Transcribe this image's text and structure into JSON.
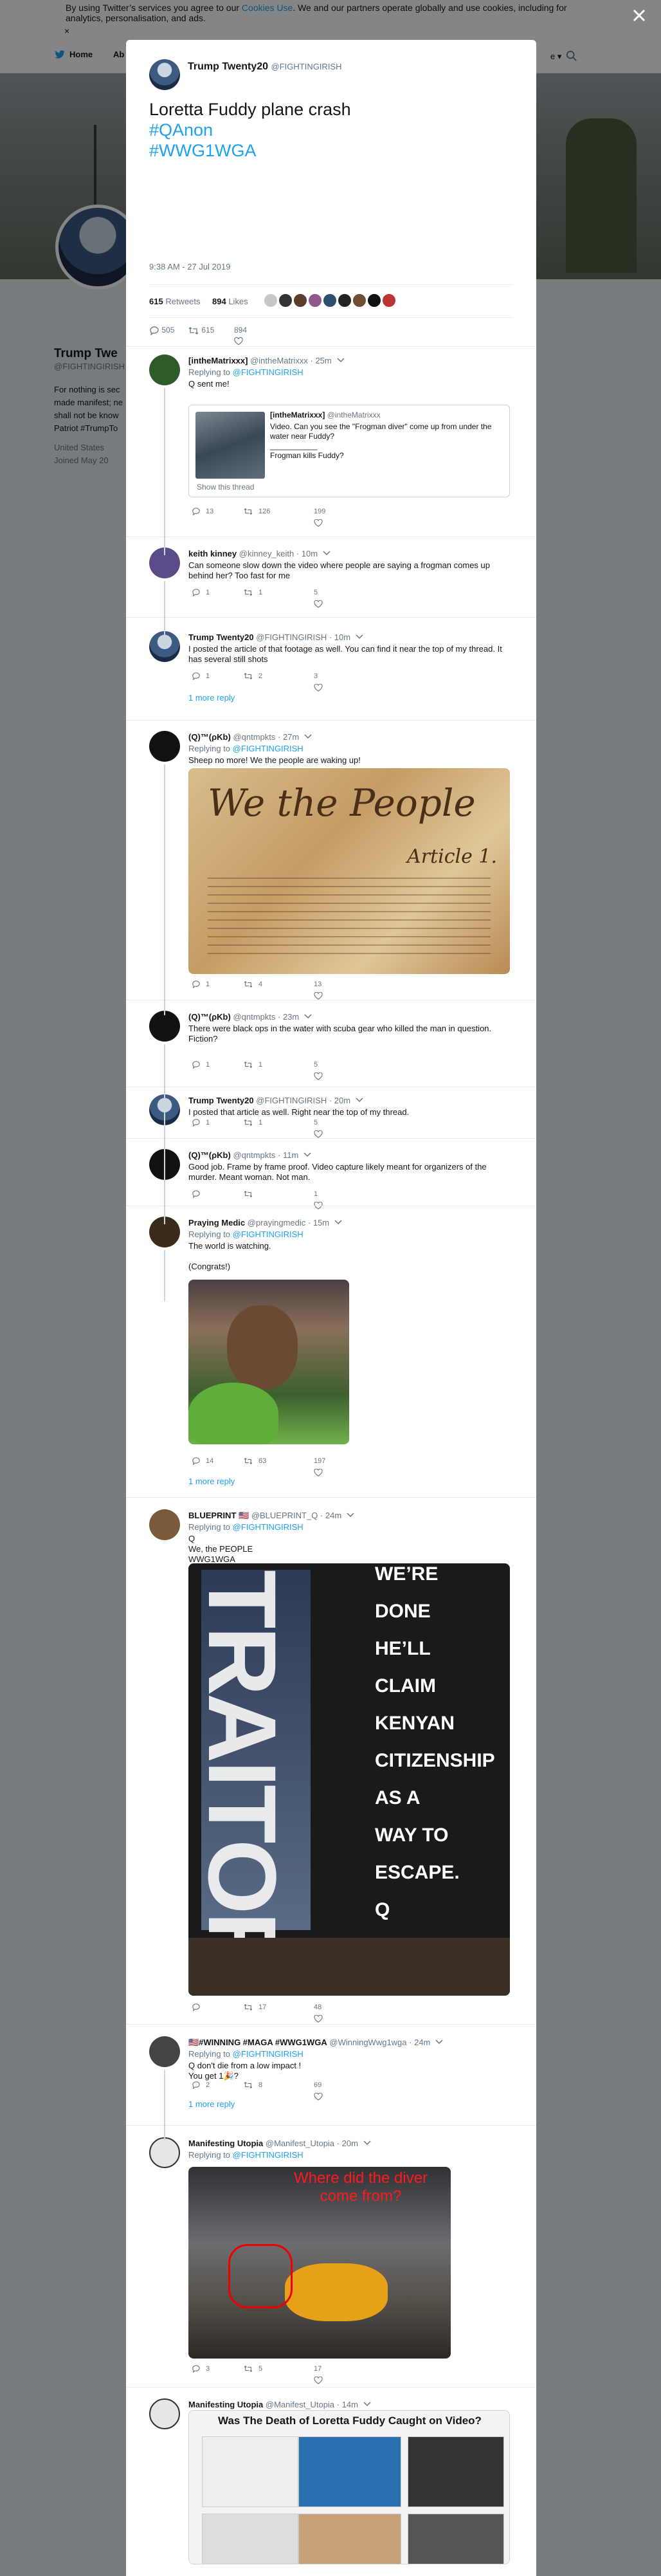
{
  "cookie_banner": {
    "text_before": "By using Twitter’s services you agree to our ",
    "link": "Cookies Use",
    "text_after": ". We and our partners operate globally and use cookies, including for analytics, personalisation, and ads.",
    "close": "×"
  },
  "nav": {
    "home": "Home",
    "about": "Ab",
    "more": "e ▾"
  },
  "profile": {
    "name": "Trump Twe",
    "handle": "@FIGHTINGIRISH",
    "bio": "For nothing is sec made manifest; ne shall not be know Patriot #TrumpTo",
    "location": "United States",
    "joined": "Joined May 20"
  },
  "tweet": {
    "author_name": "Trump Twenty20",
    "author_handle": "@FIGHTINGIRISH",
    "text": "Loretta Fuddy plane crash",
    "hashtags": [
      "#QAnon",
      "#WWG1WGA"
    ],
    "timestamp": "9:38 AM - 27 Jul 2019",
    "retweets_count": "615",
    "retweets_label": "Retweets",
    "likes_count": "894",
    "likes_label": "Likes",
    "reply_count": "505",
    "retweet_count": "615",
    "like_count": "894"
  },
  "replies": [
    {
      "name": "[intheMatrixxx]",
      "handle": "@intheMatrixxx",
      "time": "· 25m",
      "replying": "Replying to",
      "to": "@FIGHTINGIRISH",
      "text": "Q sent me!",
      "quote": {
        "name": "[intheMatrixxx]",
        "handle": "@intheMatrixxx",
        "text": "Video. Can you see the \"Frogman diver\" come up from under the water near Fuddy?\n___________\nFrogman kills Fuddy?",
        "show": "Show this thread"
      },
      "reply_count": "13",
      "retweet_count": "126",
      "like_count": "199"
    },
    {
      "name": "keith kinney",
      "handle": "@kinney_keith",
      "time": "· 10m",
      "text": "Can someone slow down the video where people are saying a frogman comes up behind her? Too fast for me",
      "reply_count": "1",
      "retweet_count": "1",
      "like_count": "5"
    },
    {
      "name": "Trump Twenty20",
      "handle": "@FIGHTINGIRISH",
      "time": "· 10m",
      "text": "I posted the article of that footage as well. You can find it near the top of my thread. It has several still shots",
      "reply_count": "1",
      "retweet_count": "2",
      "like_count": "3",
      "more": "1 more reply"
    },
    {
      "name": "(Q)™(ρKb)",
      "handle": "@qntmpkts",
      "time": "· 27m",
      "replying": "Replying to",
      "to": "@FIGHTINGIRISH",
      "text": "Sheep no more! We the people are waking up!",
      "media_text": "We the People",
      "media_sub": "Article 1.",
      "reply_count": "1",
      "retweet_count": "4",
      "like_count": "13"
    },
    {
      "name": "(Q)™(ρKb)",
      "handle": "@qntmpkts",
      "time": "· 23m",
      "text": "There were black ops in the water with scuba gear who killed the man in question.\nFiction?",
      "reply_count": "1",
      "retweet_count": "1",
      "like_count": "5"
    },
    {
      "name": "Trump Twenty20",
      "handle": "@FIGHTINGIRISH",
      "time": "· 20m",
      "text": "I posted that article as well. Right near the top of my thread.",
      "reply_count": "1",
      "retweet_count": "1",
      "like_count": "5"
    },
    {
      "name": "(Q)™(ρKb)",
      "handle": "@qntmpkts",
      "time": "· 11m",
      "text": "Good job. Frame by frame proof. Video capture likely meant for organizers of the murder. Meant woman. Not man.",
      "reply_count": "",
      "retweet_count": "",
      "like_count": "1"
    },
    {
      "name": "Praying Medic",
      "handle": "@prayingmedic",
      "time": "· 15m",
      "replying": "Replying to",
      "to": "@FIGHTINGIRISH",
      "text": "The world is watching.\n\n(Congrats!)",
      "reply_count": "14",
      "retweet_count": "63",
      "like_count": "197",
      "more": "1 more reply"
    },
    {
      "name": "BLUEPRINT 🇺🇸",
      "handle": "@BLUEPRINT_Q",
      "time": "· 24m",
      "replying": "Replying to",
      "to": "@FIGHTINGIRISH",
      "text": "Q\nWe, the PEOPLE\nWWG1WGA",
      "media_lines": [
        "WE’RE",
        "DONE",
        "HE’LL",
        "CLAIM",
        "KENYAN",
        "CITIZENSHIP",
        "AS A",
        "WAY TO",
        "ESCAPE.",
        "Q"
      ],
      "media_vertical": "TRAITOR",
      "reply_count": "",
      "retweet_count": "17",
      "like_count": "48"
    },
    {
      "name": "🇺🇸#WINNING #MAGA #WWG1WGA",
      "handle": "@WinningWwg1wga",
      "time": "· 24m",
      "replying": "Replying to",
      "to": "@FIGHTINGIRISH",
      "text": "Q don't die from a low impact !\nYou get 1🎉?",
      "reply_count": "2",
      "retweet_count": "8",
      "like_count": "69",
      "more": "1 more reply"
    },
    {
      "name": "Manifesting Utopia",
      "handle": "@Manifest_Utopia",
      "time": "· 20m",
      "replying": "Replying to",
      "to": "@FIGHTINGIRISH",
      "media_text": "Where did the diver come from?",
      "reply_count": "3",
      "retweet_count": "5",
      "like_count": "17"
    },
    {
      "name": "Manifesting Utopia",
      "handle": "@Manifest_Utopia",
      "time": "· 14m",
      "media_title": "Was The Death of Loretta Fuddy Caught on Video?"
    }
  ],
  "colors": {
    "accent": "#1da1f2",
    "muted": "#657786",
    "line": "#e6ecf0"
  }
}
